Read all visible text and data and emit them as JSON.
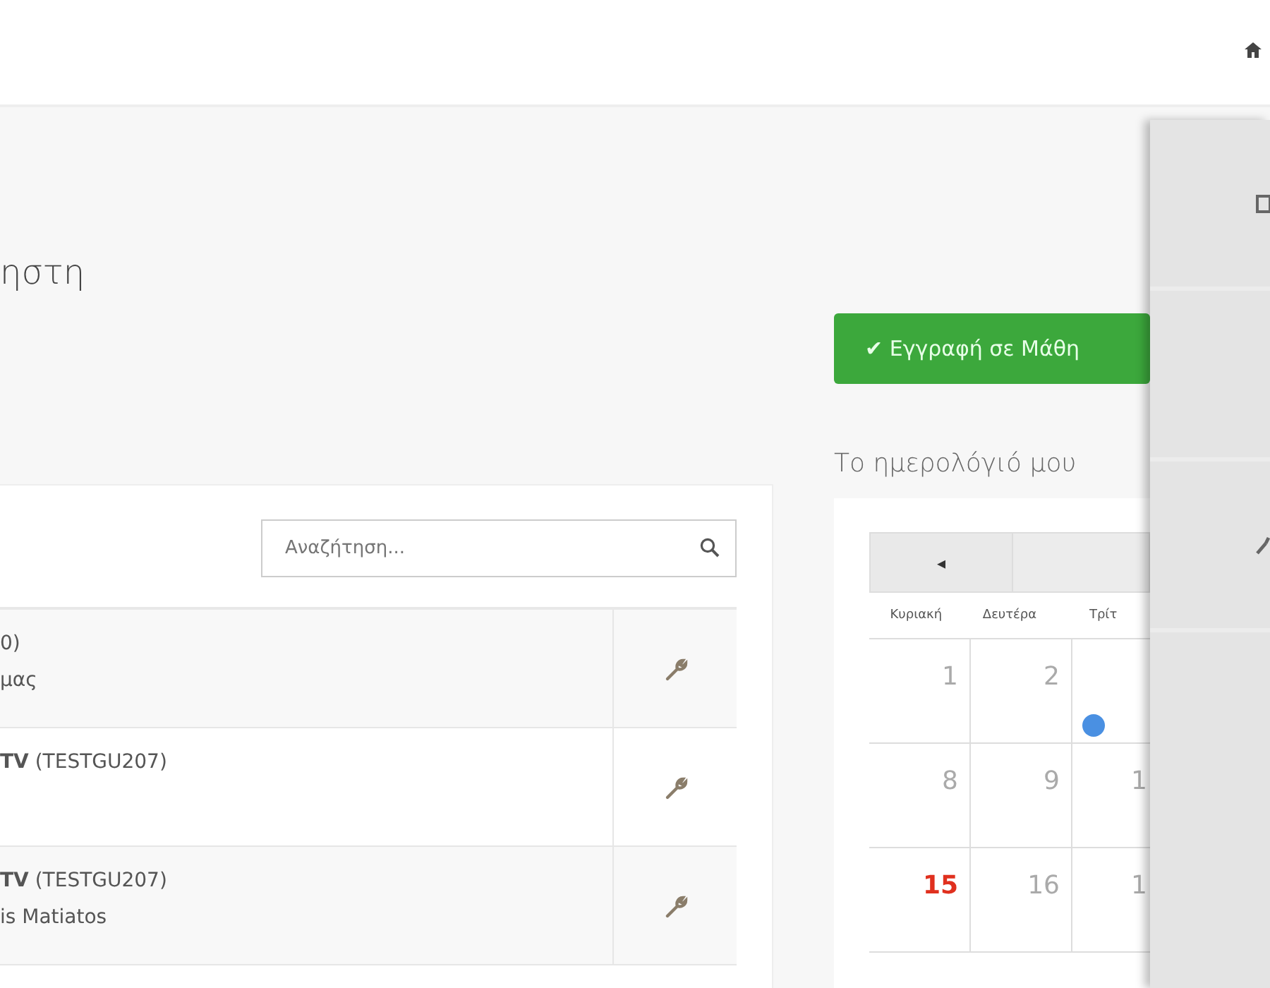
{
  "page_title": "ηστη",
  "search": {
    "placeholder": "Αναζήτηση..."
  },
  "courses": [
    {
      "title": "0)",
      "subtitle": "μας"
    },
    {
      "title": "**TV** (TESTGU207)"
    },
    {
      "title": "**TV** (TESTGU207)",
      "subtitle": "is Matiatos"
    }
  ],
  "enroll_button": "✔ Εγγραφή σε Μάθη",
  "calendar": {
    "title": "Το ημερολόγιό μου",
    "prev": "◂",
    "weekdays": [
      "Κυριακή",
      "Δευτέρα",
      "Τρίτ"
    ],
    "weeks": [
      [
        {
          "day": "1",
          "highlighted": false,
          "event": false
        },
        {
          "day": "2",
          "highlighted": false,
          "event": false
        },
        {
          "event": true
        }
      ],
      [
        {
          "day": "8",
          "highlighted": false,
          "event": false
        },
        {
          "day": "9",
          "highlighted": false,
          "event": false
        },
        {
          "day": "1",
          "highlighted": false,
          "event": false
        }
      ],
      [
        {
          "day": "15",
          "highlighted": true,
          "event": false
        },
        {
          "day": "16",
          "highlighted": false,
          "event": false
        },
        {
          "day": "1",
          "highlighted": false,
          "event": false
        }
      ]
    ]
  }
}
